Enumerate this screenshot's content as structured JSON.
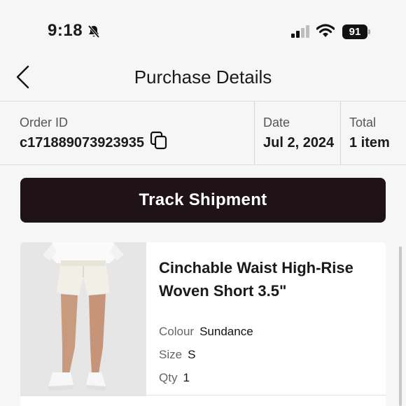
{
  "status": {
    "time": "9:18",
    "battery": "91"
  },
  "nav": {
    "title": "Purchase Details"
  },
  "order": {
    "id_label": "Order ID",
    "id_value": "c171889073923935",
    "date_label": "Date",
    "date_value": "Jul 2, 2024",
    "total_label": "Total",
    "total_value": "1 item"
  },
  "actions": {
    "track_label": "Track Shipment"
  },
  "item": {
    "name": "Cinchable Waist High-Rise Woven Short 3.5\"",
    "colour_label": "Colour",
    "colour_value": "Sundance",
    "size_label": "Size",
    "size_value": "S",
    "qty_label": "Qty",
    "qty_value": "1"
  },
  "icons": {
    "status": [
      "bell-muted-icon",
      "signal-icon",
      "wifi-icon",
      "battery-icon"
    ],
    "nav": [
      "back-chevron-icon"
    ],
    "order": [
      "copy-icon"
    ]
  },
  "colors": {
    "button_bg": "#1f1317",
    "page_bg": "#f6f6f6"
  }
}
